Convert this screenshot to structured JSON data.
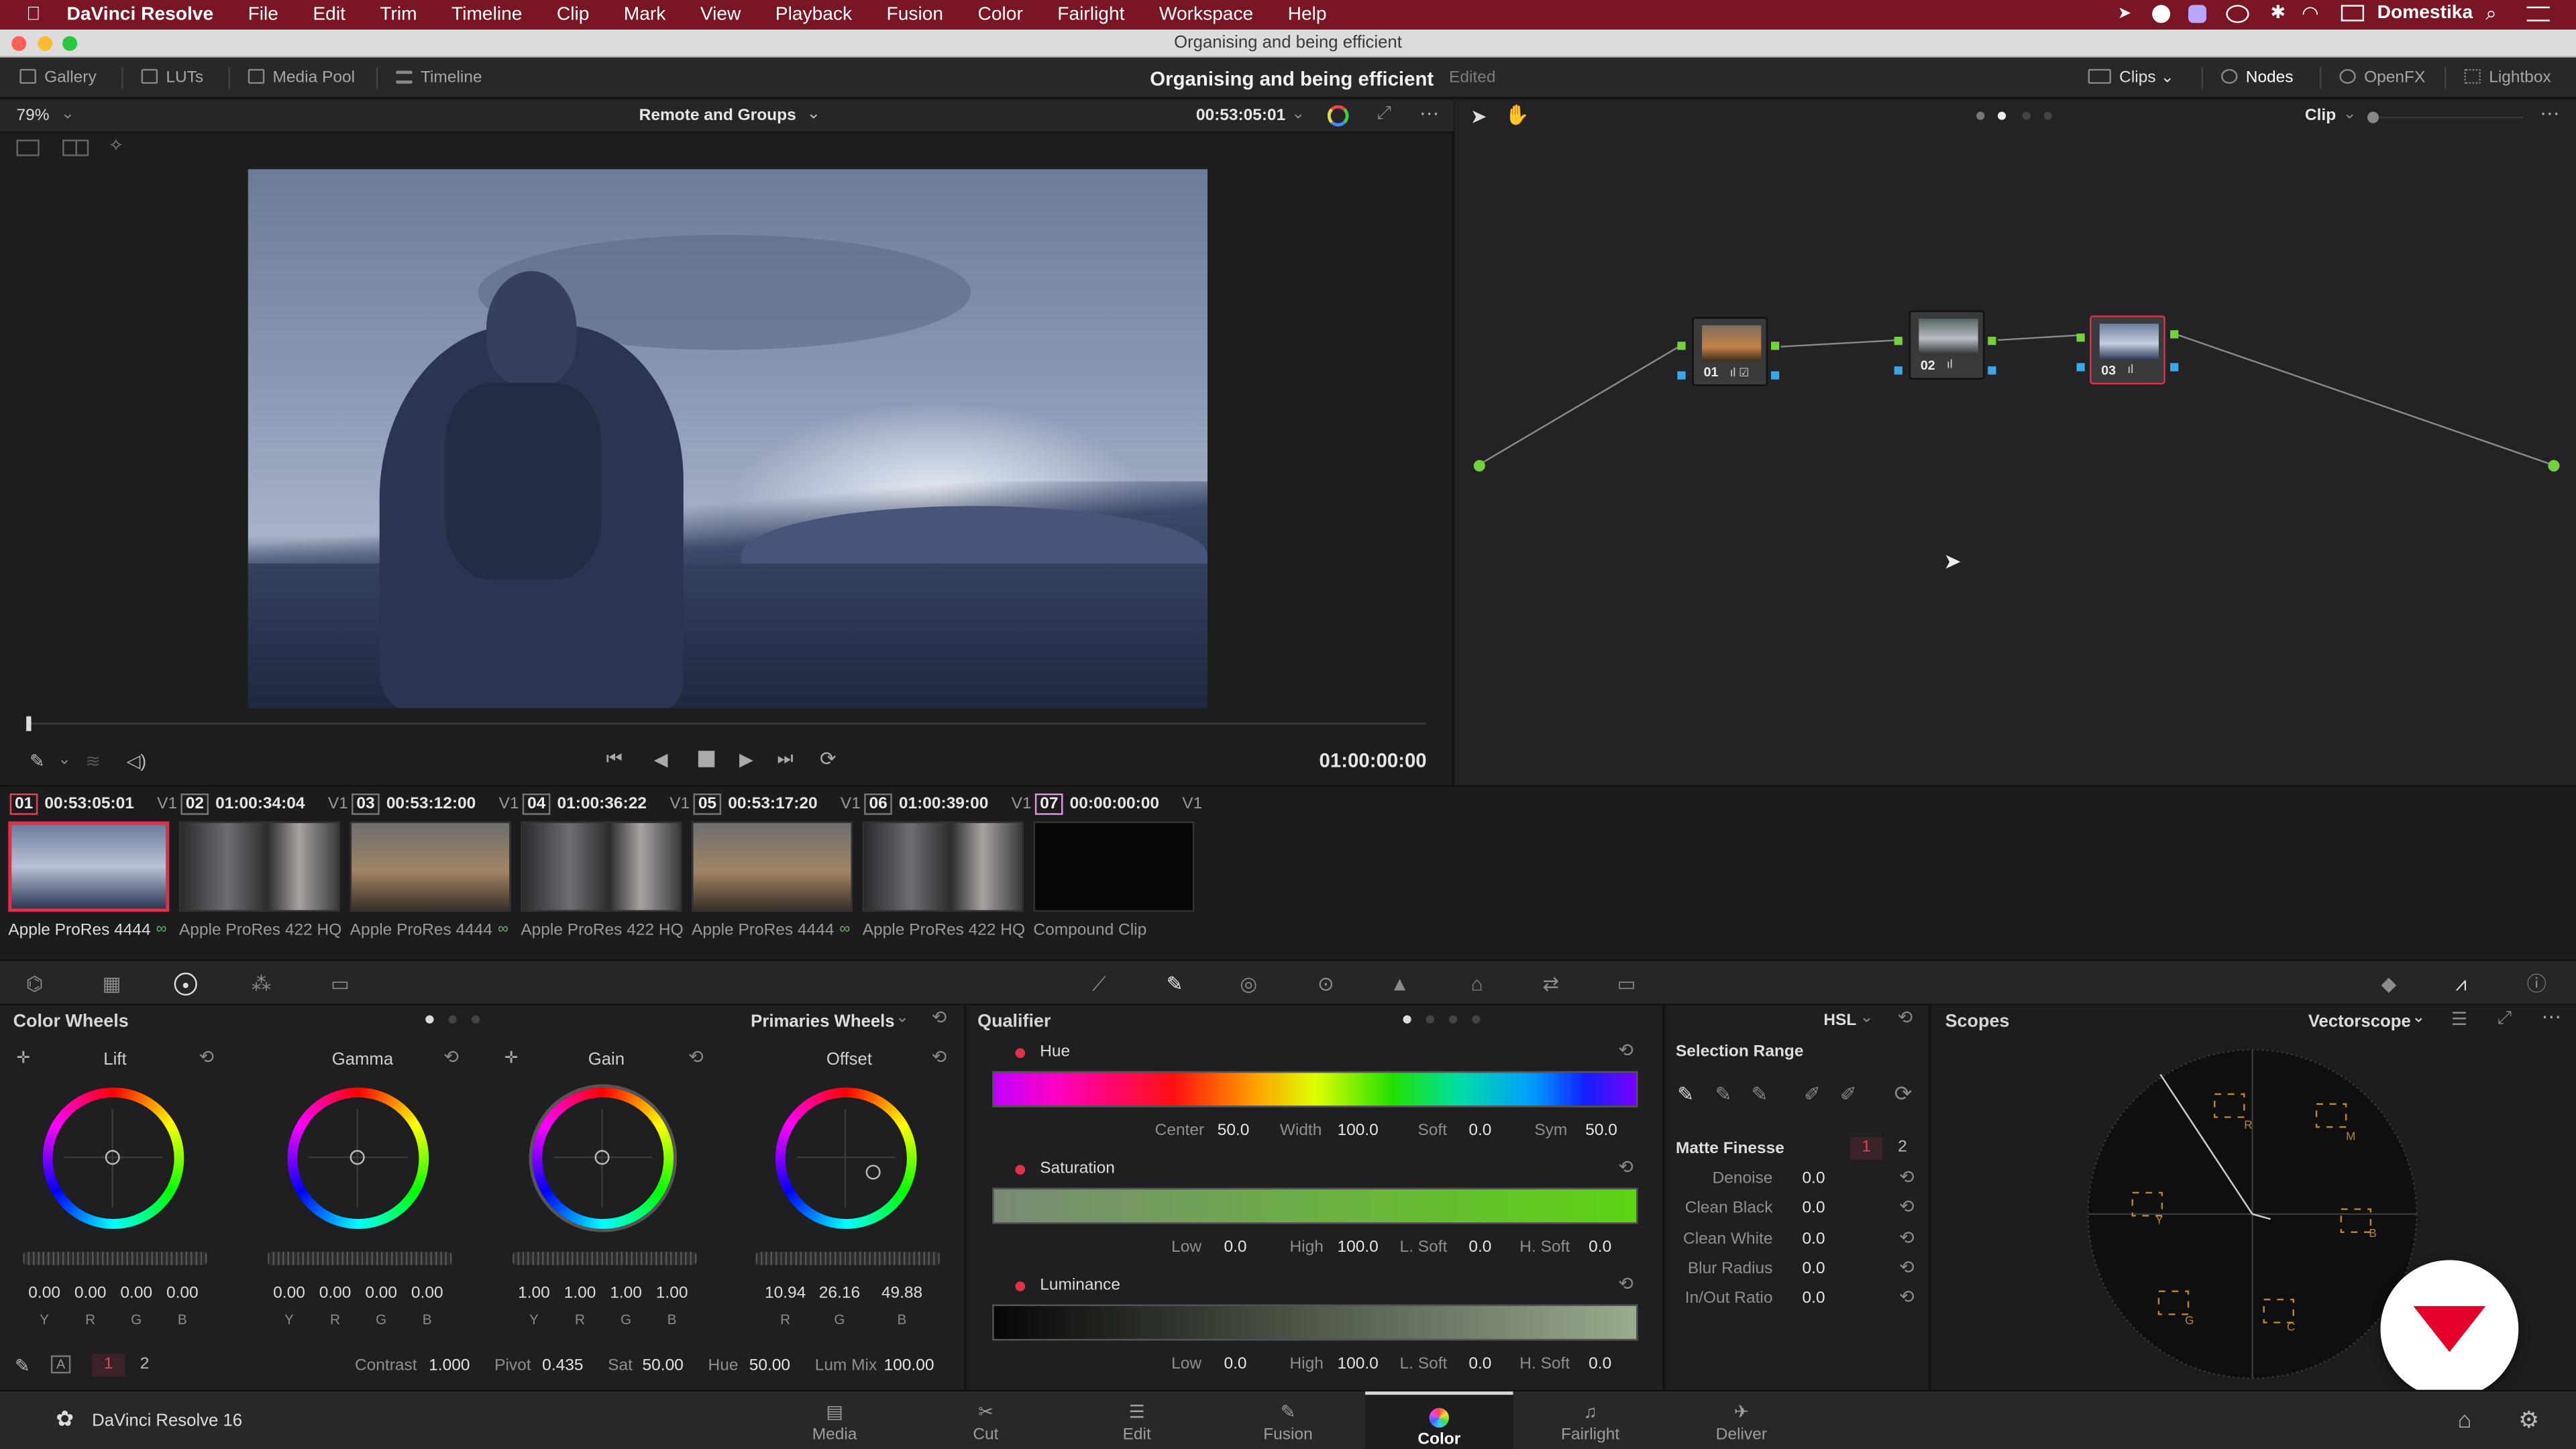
{
  "menubar": {
    "apple": "",
    "app": "DaVinci Resolve",
    "items": [
      "File",
      "Edit",
      "Trim",
      "Timeline",
      "Clip",
      "Mark",
      "View",
      "Playback",
      "Fusion",
      "Color",
      "Fairlight",
      "Workspace",
      "Help"
    ],
    "user": "Domestika"
  },
  "window": {
    "title": "Organising and being efficient"
  },
  "header": {
    "left_buttons": [
      "Gallery",
      "LUTs",
      "Media Pool",
      "Timeline"
    ],
    "project": "Organising and being efficient",
    "status": "Edited",
    "right_buttons": [
      "Clips",
      "Nodes",
      "OpenFX",
      "Lightbox"
    ]
  },
  "viewer": {
    "zoom": "79%",
    "timeline_name": "Remote and Groups",
    "source_tc": "00:53:05:01",
    "record_tc": "01:00:00:00"
  },
  "node_editor": {
    "mode": "Clip",
    "nodes": [
      "01",
      "02",
      "03"
    ]
  },
  "thumbnails": [
    {
      "num": "01",
      "tc": "00:53:05:01",
      "track": "V1",
      "codec": "Apple ProRes 4444"
    },
    {
      "num": "02",
      "tc": "01:00:34:04",
      "track": "V1",
      "codec": "Apple ProRes 422 HQ"
    },
    {
      "num": "03",
      "tc": "00:53:12:00",
      "track": "V1",
      "codec": "Apple ProRes 4444"
    },
    {
      "num": "04",
      "tc": "01:00:36:22",
      "track": "V1",
      "codec": "Apple ProRes 422 HQ"
    },
    {
      "num": "05",
      "tc": "00:53:17:20",
      "track": "V1",
      "codec": "Apple ProRes 4444"
    },
    {
      "num": "06",
      "tc": "01:00:39:00",
      "track": "V1",
      "codec": "Apple ProRes 422 HQ"
    },
    {
      "num": "07",
      "tc": "00:00:00:00",
      "track": "V1",
      "codec": "Compound Clip"
    }
  ],
  "color_wheels": {
    "title": "Color Wheels",
    "mode": "Primaries Wheels",
    "wheels": [
      {
        "name": "Lift",
        "values": [
          "0.00",
          "0.00",
          "0.00",
          "0.00"
        ],
        "channels": [
          "Y",
          "R",
          "G",
          "B"
        ]
      },
      {
        "name": "Gamma",
        "values": [
          "0.00",
          "0.00",
          "0.00",
          "0.00"
        ],
        "channels": [
          "Y",
          "R",
          "G",
          "B"
        ]
      },
      {
        "name": "Gain",
        "values": [
          "1.00",
          "1.00",
          "1.00",
          "1.00"
        ],
        "channels": [
          "Y",
          "R",
          "G",
          "B"
        ]
      },
      {
        "name": "Offset",
        "values": [
          "10.94",
          "26.16",
          "49.88"
        ],
        "channels": [
          "R",
          "G",
          "B"
        ]
      }
    ],
    "page_a": "1",
    "page_b": "2",
    "footer": {
      "contrast_label": "Contrast",
      "contrast": "1.000",
      "pivot_label": "Pivot",
      "pivot": "0.435",
      "sat_label": "Sat",
      "sat": "50.00",
      "hue_label": "Hue",
      "hue": "50.00",
      "lummix_label": "Lum Mix",
      "lummix": "100.00"
    }
  },
  "qualifier": {
    "title": "Qualifier",
    "hue": {
      "label": "Hue",
      "center_label": "Center",
      "center": "50.0",
      "width_label": "Width",
      "width": "100.0",
      "soft_label": "Soft",
      "soft": "0.0",
      "sym_label": "Sym",
      "sym": "50.0"
    },
    "saturation": {
      "label": "Saturation",
      "low_label": "Low",
      "low": "0.0",
      "high_label": "High",
      "high": "100.0",
      "lsoft_label": "L. Soft",
      "lsoft": "0.0",
      "hsoft_label": "H. Soft",
      "hsoft": "0.0"
    },
    "luminance": {
      "label": "Luminance",
      "low_label": "Low",
      "low": "0.0",
      "high_label": "High",
      "high": "100.0",
      "lsoft_label": "L. Soft",
      "lsoft": "0.0",
      "hsoft_label": "H. Soft",
      "hsoft": "0.0"
    }
  },
  "selection": {
    "mode": "HSL",
    "title": "Selection Range",
    "matte_title": "Matte Finesse",
    "page_a": "1",
    "page_b": "2",
    "rows": [
      {
        "label": "Denoise",
        "value": "0.0"
      },
      {
        "label": "Clean Black",
        "value": "0.0"
      },
      {
        "label": "Clean White",
        "value": "0.0"
      },
      {
        "label": "Blur Radius",
        "value": "0.0"
      },
      {
        "label": "In/Out Ratio",
        "value": "0.0"
      }
    ]
  },
  "scopes": {
    "title": "Scopes",
    "mode": "Vectorscope",
    "targets": [
      "R",
      "M",
      "B",
      "C",
      "G",
      "Y"
    ]
  },
  "footer": {
    "app_version": "DaVinci Resolve 16",
    "pages": [
      "Media",
      "Cut",
      "Edit",
      "Fusion",
      "Color",
      "Fairlight",
      "Deliver"
    ],
    "active_page": "Color"
  }
}
